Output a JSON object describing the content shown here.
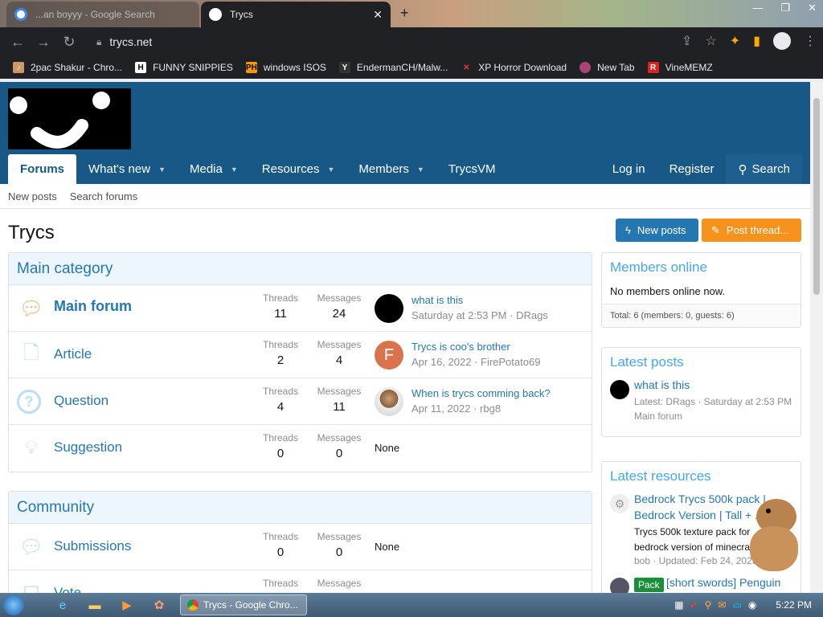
{
  "browser": {
    "tabs": [
      {
        "title": "...an boyyy - Google Search",
        "active": false
      },
      {
        "title": "Trycs",
        "active": true
      }
    ],
    "url": "trycs.net",
    "bookmarks": [
      {
        "label": "2pac Shakur - Chro...",
        "icon": "music-icon"
      },
      {
        "label": "FUNNY SNIPPIES",
        "icon": "H"
      },
      {
        "label": "windows ISOS",
        "icon": "PH"
      },
      {
        "label": "EndermanCH/Malw...",
        "icon": "Y"
      },
      {
        "label": "XP Horror Download",
        "icon": "X"
      },
      {
        "label": "New Tab",
        "icon": "globe-icon"
      },
      {
        "label": "VineMEMZ",
        "icon": "R"
      }
    ]
  },
  "site": {
    "nav": [
      "Forums",
      "What's new",
      "Media",
      "Resources",
      "Members",
      "TrycsVM"
    ],
    "nav_right": [
      "Log in",
      "Register",
      "Search"
    ],
    "subnav": [
      "New posts",
      "Search forums"
    ],
    "page_title": "Trycs",
    "buttons": {
      "new_posts": "New posts",
      "post_thread": "Post thread..."
    }
  },
  "main_category": {
    "title": "Main category",
    "nodes": [
      {
        "title": "Main forum",
        "threads_label": "Threads",
        "threads": "11",
        "messages_label": "Messages",
        "messages": "24",
        "last_title": "what is this",
        "last_meta": "Saturday at 2:53 PM · DRags",
        "avatar_letter": "",
        "avatar_color": "#000000"
      },
      {
        "title": "Article",
        "threads_label": "Threads",
        "threads": "2",
        "messages_label": "Messages",
        "messages": "4",
        "last_title": "Trycs is coo's brother",
        "last_meta": "Apr 16, 2022 · FirePotato69",
        "avatar_letter": "F",
        "avatar_color": "#d9734e"
      },
      {
        "title": "Question",
        "threads_label": "Threads",
        "threads": "4",
        "messages_label": "Messages",
        "messages": "11",
        "last_title": "When is trycs comming back?",
        "last_meta": "Apr 11, 2022 · rbg8",
        "avatar_letter": "",
        "avatar_color": "#8a7060"
      },
      {
        "title": "Suggestion",
        "threads_label": "Threads",
        "threads": "0",
        "messages_label": "Messages",
        "messages": "0",
        "last_none": "None"
      }
    ]
  },
  "community": {
    "title": "Community",
    "nodes": [
      {
        "title": "Submissions",
        "threads_label": "Threads",
        "threads": "0",
        "messages_label": "Messages",
        "messages": "0",
        "last_none": "None"
      },
      {
        "title": "Vote",
        "threads_label": "Threads",
        "messages_label": "Messages"
      }
    ]
  },
  "sidebar": {
    "members_online": {
      "title": "Members online",
      "body": "No members online now.",
      "footer": "Total: 6 (members: 0, guests: 6)"
    },
    "latest_posts": {
      "title": "Latest posts",
      "post_title": "what is this",
      "post_meta": "Latest: DRags · Saturday at 2:53 PM",
      "post_forum": "Main forum"
    },
    "latest_resources": {
      "title": "Latest resources",
      "res1_title": "Bedrock Trycs 500k pack | Bedrock Version | Tall + ...",
      "res1_desc": "Trycs 500k texture pack for bedrock version of minecraft",
      "res1_meta": "bob · Updated: Feb 24, 2023",
      "res2_badge": "Pack",
      "res2_title": "[short swords] Penguin"
    }
  },
  "taskbar": {
    "task_label": "Trycs - Google Chro...",
    "clock": "5:22 PM"
  }
}
